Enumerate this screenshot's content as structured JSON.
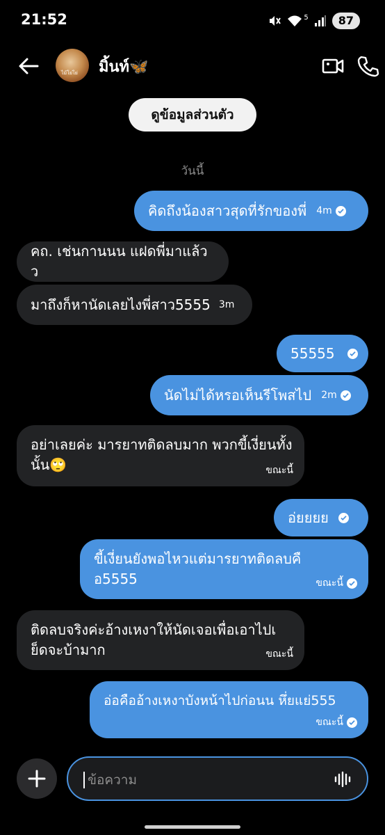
{
  "status_bar": {
    "time": "21:52",
    "signal_label": "5",
    "battery": "87"
  },
  "header": {
    "contact_name": "มิ้นท์🦋",
    "avatar_mark": "ไม้โย่โย่"
  },
  "profile_button": "ดูข้อมูลส่วนตัว",
  "date_separator": "วันนี้",
  "messages": [
    {
      "side": "out",
      "text": "คิดถึงน้องสาวสุดที่รักของพี่",
      "time": "4m"
    },
    {
      "side": "in",
      "text": "คถ. เช่นกานนน แฝดพี่มาแล้วว",
      "time": ""
    },
    {
      "side": "in",
      "text": "มาถึงก็หานัดเลยไงพี่สาว5555",
      "time": "3m"
    },
    {
      "side": "out",
      "text": "55555",
      "time": ""
    },
    {
      "side": "out",
      "text": "นัดไม่ได้หรอเห็นรีโพสไป",
      "time": "2m"
    },
    {
      "side": "in",
      "text": "อย่าเลยค่ะ มารยาทติดลบมาก พวกขี้เงี่ยนทั้งนั้น🙄",
      "time": "ขณะนี้"
    },
    {
      "side": "out",
      "text": "อ่ยยยย",
      "time": ""
    },
    {
      "side": "out",
      "text": "ขี้เงี่ยนยังพอไหวแต่มารยาทติดลบคือ5555",
      "time": "ขณะนี้"
    },
    {
      "side": "in",
      "text": "ติดลบจริงค่ะอ้างเหงาให้นัดเจอเพื่อเอาไปเย็ดจะบ้ามาก",
      "time": "ขณะนี้"
    },
    {
      "side": "out",
      "text": "อ่อคืออ้างเหงาบังหน้าไปก่อนน หึ่ยแย่555",
      "time": "ขณะนี้"
    }
  ],
  "composer": {
    "placeholder": "ข้อความ",
    "value": ""
  },
  "colors": {
    "outgoing": "#4a93e0",
    "incoming": "#222325",
    "background": "#000000"
  }
}
